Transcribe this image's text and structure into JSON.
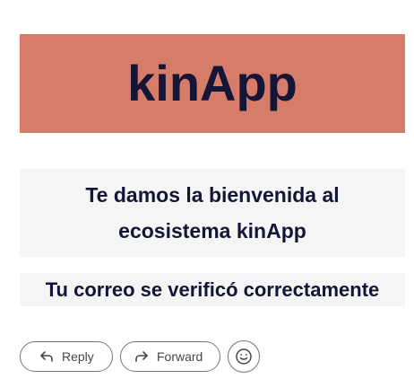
{
  "email": {
    "banner": {
      "title": "kinApp",
      "background_color": "#d57d68",
      "text_color": "#151537"
    },
    "welcome": {
      "text": "Te damos la bienvenida al ecosistema kinApp",
      "background_color": "#f5f5f5"
    },
    "verified": {
      "text": "Tu correo se verificó correctamente",
      "background_color": "#f5f5f5"
    }
  },
  "actions": {
    "reply": {
      "label": "Reply",
      "icon": "reply-icon"
    },
    "forward": {
      "label": "Forward",
      "icon": "forward-icon"
    },
    "emoji": {
      "icon": "emoji-smile-icon"
    }
  }
}
